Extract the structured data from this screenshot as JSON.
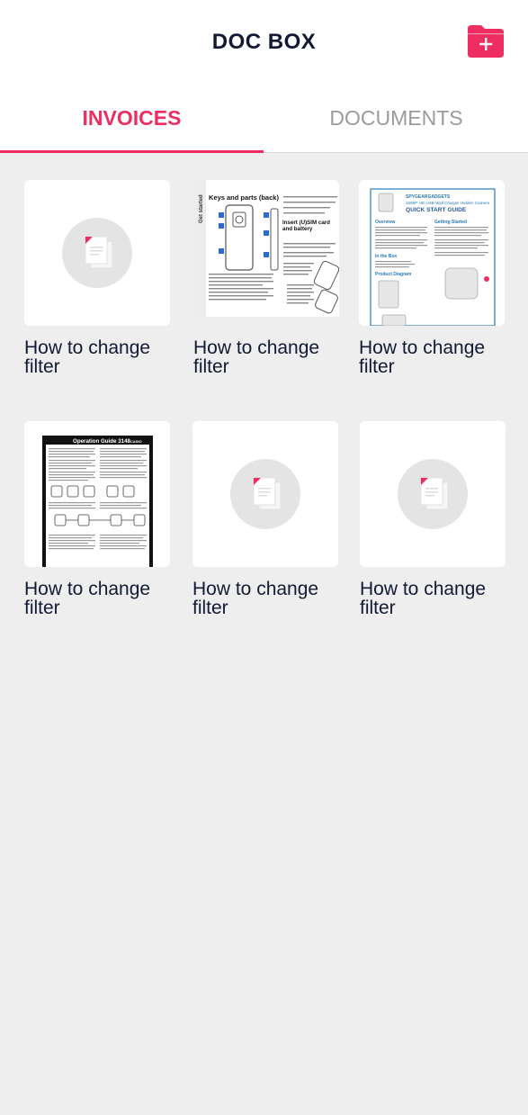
{
  "app": {
    "title": "DOC BOX"
  },
  "header": {
    "add_icon": "folder-plus-icon",
    "accent_color": "#ee2e62"
  },
  "tabs": [
    {
      "label": "INVOICES",
      "active": true
    },
    {
      "label": "DOCUMENTS",
      "active": false
    }
  ],
  "documents": [
    {
      "caption": "How to change filter",
      "thumbnail": "placeholder-file-icon"
    },
    {
      "caption": "How to change filter",
      "thumbnail": "manual-keys-and-parts-page"
    },
    {
      "caption": "How to change filter",
      "thumbnail": "quick-start-guide-page"
    },
    {
      "caption": "How to change filter",
      "thumbnail": "operation-guide-page"
    },
    {
      "caption": "How to change filter",
      "thumbnail": "placeholder-file-icon"
    },
    {
      "caption": "How to change filter",
      "thumbnail": "placeholder-file-icon"
    }
  ],
  "thumbnail_text": {
    "manual_heading": "Keys and parts (back)",
    "manual_section": "Insert (U)SIM card and battery",
    "manual_tab": "Get started",
    "guide_brand": "SPYGEARGADGETS",
    "guide_product": "1080P HD USB Wall Charger Hidden Camera",
    "guide_title": "QUICK START GUIDE",
    "guide_overview": "Overview",
    "guide_getting_started": "Getting Started",
    "guide_in_box": "In the Box",
    "guide_diagram": "Product Diagram",
    "casio_title": "Operation Guide 3148",
    "casio_brand": "CASIO"
  }
}
